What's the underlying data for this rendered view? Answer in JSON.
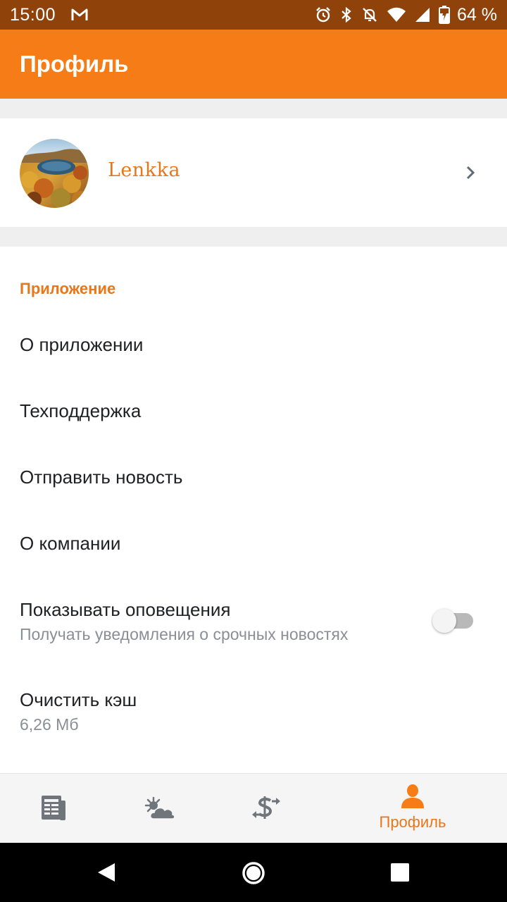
{
  "status_bar": {
    "time": "15:00",
    "battery_percent": "64 %",
    "icons": [
      "gmail-icon",
      "alarm-icon",
      "bluetooth-icon",
      "notifications-off-icon",
      "wifi-icon",
      "signal-icon",
      "battery-charging-icon"
    ]
  },
  "app_bar": {
    "title": "Профиль"
  },
  "profile": {
    "username": "Lenkka"
  },
  "settings": {
    "section_title": "Приложение",
    "about_app": "О приложении",
    "support": "Техподдержка",
    "send_news": "Отправить новость",
    "about_company": "О компании",
    "notifications_title": "Показывать оповещения",
    "notifications_subtitle": "Получать уведомления о срочных новостях",
    "notifications_enabled": false,
    "clear_cache_title": "Очистить кэш",
    "clear_cache_size": "6,26 Мб"
  },
  "bottom_nav": {
    "items": [
      {
        "icon": "news-icon",
        "label": ""
      },
      {
        "icon": "weather-icon",
        "label": ""
      },
      {
        "icon": "currency-exchange-icon",
        "label": ""
      },
      {
        "icon": "profile-icon",
        "label": "Профиль",
        "active": true
      }
    ]
  },
  "colors": {
    "accent": "#f57c16",
    "status_bar": "#8f430a",
    "accent_text": "#e8771c"
  }
}
